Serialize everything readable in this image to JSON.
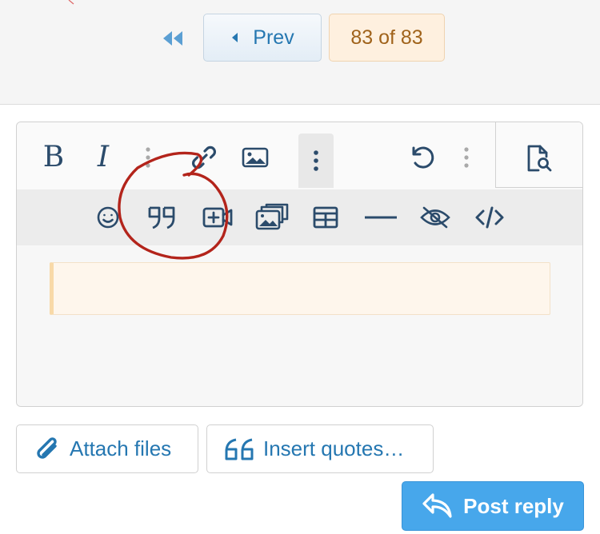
{
  "pagination": {
    "first_icon": "double-chevron-left-icon",
    "prev_label": "Prev",
    "prev_icon": "caret-left-icon",
    "page_indicator": "83 of 83"
  },
  "editor": {
    "toolbar": {
      "bold_label": "B",
      "italic_label": "I",
      "top_icons": [
        "bold-icon",
        "italic-icon",
        "more-vertical-icon",
        "link-icon",
        "image-icon",
        "more-vertical-icon",
        "undo-icon",
        "more-vertical-icon",
        "preview-icon"
      ],
      "sub_icons": [
        "smiley-icon",
        "quote-icon",
        "media-icon",
        "gallery-icon",
        "table-icon",
        "horizontal-rule-icon",
        "spoiler-icon",
        "code-icon"
      ]
    },
    "annotation": "hand-drawn red circle around quote button"
  },
  "actions": {
    "attach_label": "Attach files",
    "insert_quotes_label": "Insert quotes…",
    "post_reply_label": "Post reply"
  },
  "colors": {
    "accent": "#2577b1",
    "primary_button": "#47a7eb",
    "icon": "#2b4b6b",
    "page_indicator_bg": "#fef0df",
    "page_indicator_text": "#a0631b",
    "annotation": "#b3241b"
  }
}
